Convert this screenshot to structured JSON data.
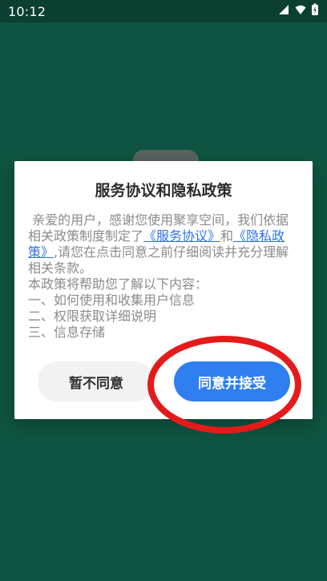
{
  "status_bar": {
    "time": "10:12",
    "icons": [
      "wifi-icon",
      "signal-icon",
      "battery-charging-icon"
    ]
  },
  "dialog": {
    "title": "服务协议和隐私政策",
    "text_1": " 亲爱的用户，感谢您使用聚享空间，我们依据相关政策制度制定了",
    "link_service": "《服务协议》",
    "text_and": "和",
    "link_privacy": "《隐私政策》",
    "text_2": ",请您在点击同意之前仔细阅读并充分理解相关条款。",
    "intro": "本政策将帮助您了解以下内容：",
    "items": [
      "一、如何使用和收集用户信息",
      "二、权限获取详细说明",
      "三、信息存储"
    ],
    "decline_label": "暂不同意",
    "accept_label": "同意并接受"
  },
  "colors": {
    "background": "#0f5442",
    "accent": "#2f7ff1",
    "annotation": "#e51a1a"
  }
}
